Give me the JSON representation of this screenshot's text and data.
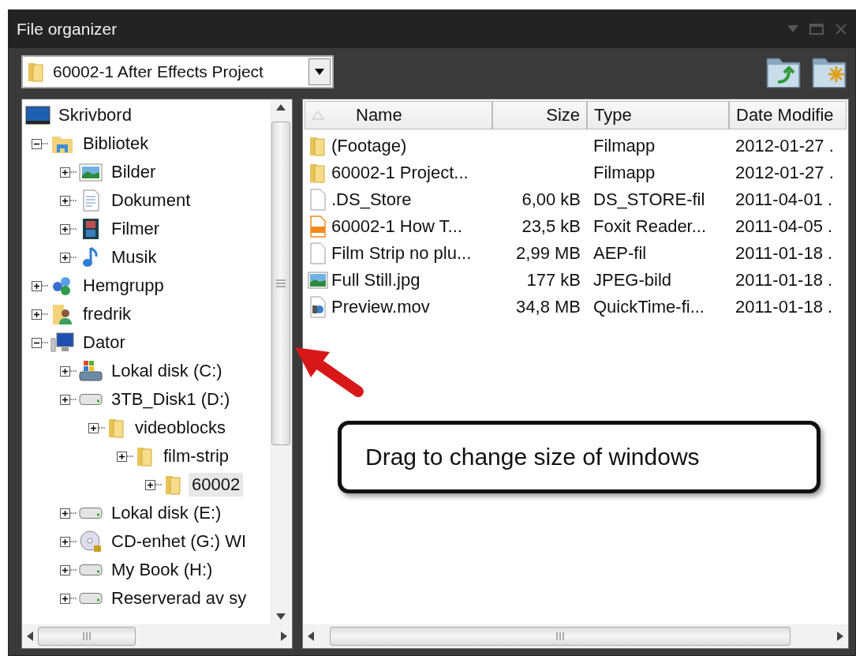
{
  "window": {
    "title": "File organizer"
  },
  "location": {
    "value": "60002-1 After Effects Project"
  },
  "tree": [
    {
      "label": "Skrivbord",
      "kind": "desktop",
      "selected": false,
      "children": [
        {
          "label": "Bibliotek",
          "kind": "library",
          "expanded": true,
          "selected": false,
          "children": [
            {
              "label": "Bilder",
              "kind": "pictures",
              "expanded": false,
              "selected": false
            },
            {
              "label": "Dokument",
              "kind": "documents",
              "expanded": false,
              "selected": false
            },
            {
              "label": "Filmer",
              "kind": "videos",
              "expanded": false,
              "selected": false
            },
            {
              "label": "Musik",
              "kind": "music",
              "expanded": false,
              "selected": false
            }
          ]
        },
        {
          "label": "Hemgrupp",
          "kind": "homegroup",
          "expanded": false,
          "selected": false
        },
        {
          "label": "fredrik",
          "kind": "user",
          "expanded": false,
          "selected": false
        },
        {
          "label": "Dator",
          "kind": "computer",
          "expanded": true,
          "selected": false,
          "children": [
            {
              "label": "Lokal disk (C:)",
              "kind": "system-drive",
              "expanded": false,
              "selected": false
            },
            {
              "label": "3TB_Disk1 (D:)",
              "kind": "drive",
              "expanded": false,
              "selected": false,
              "children": [
                {
                  "label": "videoblocks",
                  "kind": "folder",
                  "expanded": false,
                  "selected": false,
                  "children": [
                    {
                      "label": "film-strip",
                      "kind": "folder",
                      "expanded": false,
                      "selected": false,
                      "children": [
                        {
                          "label": "60002",
                          "kind": "folder",
                          "expanded": false,
                          "selected": true
                        }
                      ]
                    }
                  ]
                }
              ]
            },
            {
              "label": "Lokal disk (E:)",
              "kind": "drive",
              "expanded": false,
              "selected": false
            },
            {
              "label": "CD-enhet (G:) WI",
              "kind": "cd",
              "expanded": false,
              "selected": false
            },
            {
              "label": "My Book (H:)",
              "kind": "drive",
              "expanded": false,
              "selected": false
            },
            {
              "label": "Reserverad av sy",
              "kind": "drive",
              "expanded": false,
              "selected": false
            }
          ]
        }
      ]
    }
  ],
  "table": {
    "columns": [
      "Name",
      "Size",
      "Type",
      "Date Modifie"
    ],
    "rows": [
      {
        "kind": "folder",
        "name": "(Footage)",
        "size": "",
        "type": "Filmapp",
        "date": "2012-01-27 ."
      },
      {
        "kind": "folder",
        "name": "60002-1 Project...",
        "size": "",
        "type": "Filmapp",
        "date": "2012-01-27 ."
      },
      {
        "kind": "file",
        "name": ".DS_Store",
        "size": "6,00 kB",
        "type": "DS_STORE-fil",
        "date": "2011-04-01 ."
      },
      {
        "kind": "pdf",
        "name": "60002-1 How T...",
        "size": "23,5 kB",
        "type": "Foxit Reader...",
        "date": "2011-04-05 ."
      },
      {
        "kind": "file",
        "name": "Film Strip no plu...",
        "size": "2,99 MB",
        "type": "AEP-fil",
        "date": "2011-01-18 ."
      },
      {
        "kind": "image",
        "name": "Full Still.jpg",
        "size": "177 kB",
        "type": "JPEG-bild",
        "date": "2011-01-18 ."
      },
      {
        "kind": "video",
        "name": "Preview.mov",
        "size": "34,8 MB",
        "type": "QuickTime-fi...",
        "date": "2011-01-18 ."
      }
    ]
  },
  "callout": {
    "text": "Drag to change size of windows"
  }
}
